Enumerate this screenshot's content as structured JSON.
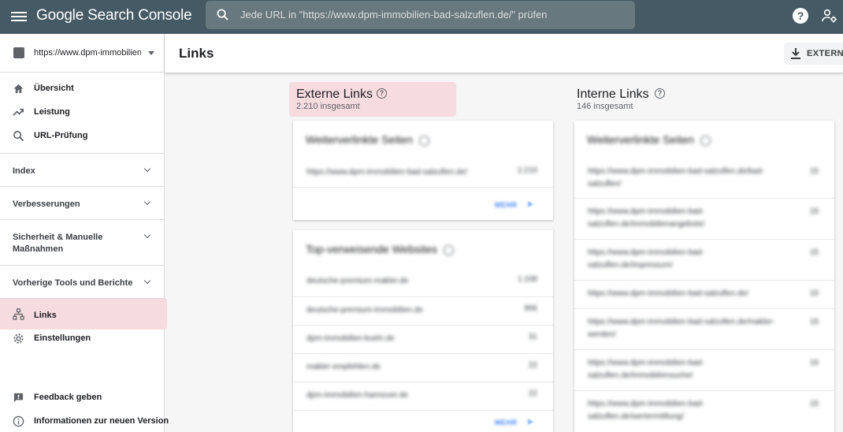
{
  "app": {
    "brand": "Google Search Console",
    "search_placeholder": "Jede URL in \"https://www.dpm-immobilien-bad-salzuflen.de/\" prüfen"
  },
  "sidebar": {
    "property": "https://www.dpm-immobilien ...",
    "items_top": [
      {
        "label": "Übersicht",
        "icon": "home-icon"
      },
      {
        "label": "Leistung",
        "icon": "trending-up-icon"
      },
      {
        "label": "URL-Prüfung",
        "icon": "search-icon"
      }
    ],
    "sections": [
      {
        "label": "Index"
      },
      {
        "label": "Verbesserungen"
      },
      {
        "label": "Sicherheit & Manuelle Maßnahmen"
      },
      {
        "label": "Vorherige Tools und Berichte"
      }
    ],
    "items_bottom": [
      {
        "label": "Links",
        "icon": "sitemap-icon",
        "active": true
      },
      {
        "label": "Einstellungen",
        "icon": "gear-icon"
      }
    ],
    "footer": [
      {
        "label": "Feedback geben",
        "icon": "feedback-icon"
      },
      {
        "label": "Informationen zur neuen Version",
        "icon": "info-icon"
      }
    ]
  },
  "header": {
    "title": "Links",
    "export_label": "EXTERNE"
  },
  "external": {
    "title": "Externe Links",
    "subtitle": "2.210 insgesamt",
    "linked_pages": {
      "title": "Weiterverlinkte Seiten",
      "rows": [
        {
          "url": "https://www.dpm-immobilien-bad-salzuflen.de/",
          "count": "2.210"
        }
      ],
      "more": "MEHR"
    },
    "top_sites": {
      "title": "Top-verweisende Websites",
      "rows": [
        {
          "url": "deutsche-premium-makler.de",
          "count": "1.108"
        },
        {
          "url": "deutsche-premium-immobilien.de",
          "count": "956"
        },
        {
          "url": "dpm-immobilien-koeln.de",
          "count": "31"
        },
        {
          "url": "makler-empfehlen.de",
          "count": "22"
        },
        {
          "url": "dpm-immobilien-hannover.de",
          "count": "22"
        }
      ],
      "more": "MEHR"
    }
  },
  "internal": {
    "title": "Interne Links",
    "subtitle": "146 insgesamt",
    "linked_pages": {
      "title": "Weiterverlinkte Seiten",
      "rows": [
        {
          "url": "https://www.dpm-immobilien-bad-salzuflen.de/bad-salzuflen/",
          "count": "15"
        },
        {
          "url": "https://www.dpm-immobilien-bad-salzuflen.de/immobilienangebote/",
          "count": "15"
        },
        {
          "url": "https://www.dpm-immobilien-bad-salzuflen.de/impressum/",
          "count": "15"
        },
        {
          "url": "https://www.dpm-immobilien-bad-salzuflen.de/",
          "count": "15"
        },
        {
          "url": "https://www.dpm-immobilien-bad-salzuflen.de/makler-werden/",
          "count": "15"
        },
        {
          "url": "https://www.dpm-immobilien-bad-salzuflen.de/immobiliensuche/",
          "count": "15"
        },
        {
          "url": "https://www.dpm-immobilien-bad-salzuflen.de/wertermittlung/",
          "count": "15"
        }
      ]
    }
  }
}
